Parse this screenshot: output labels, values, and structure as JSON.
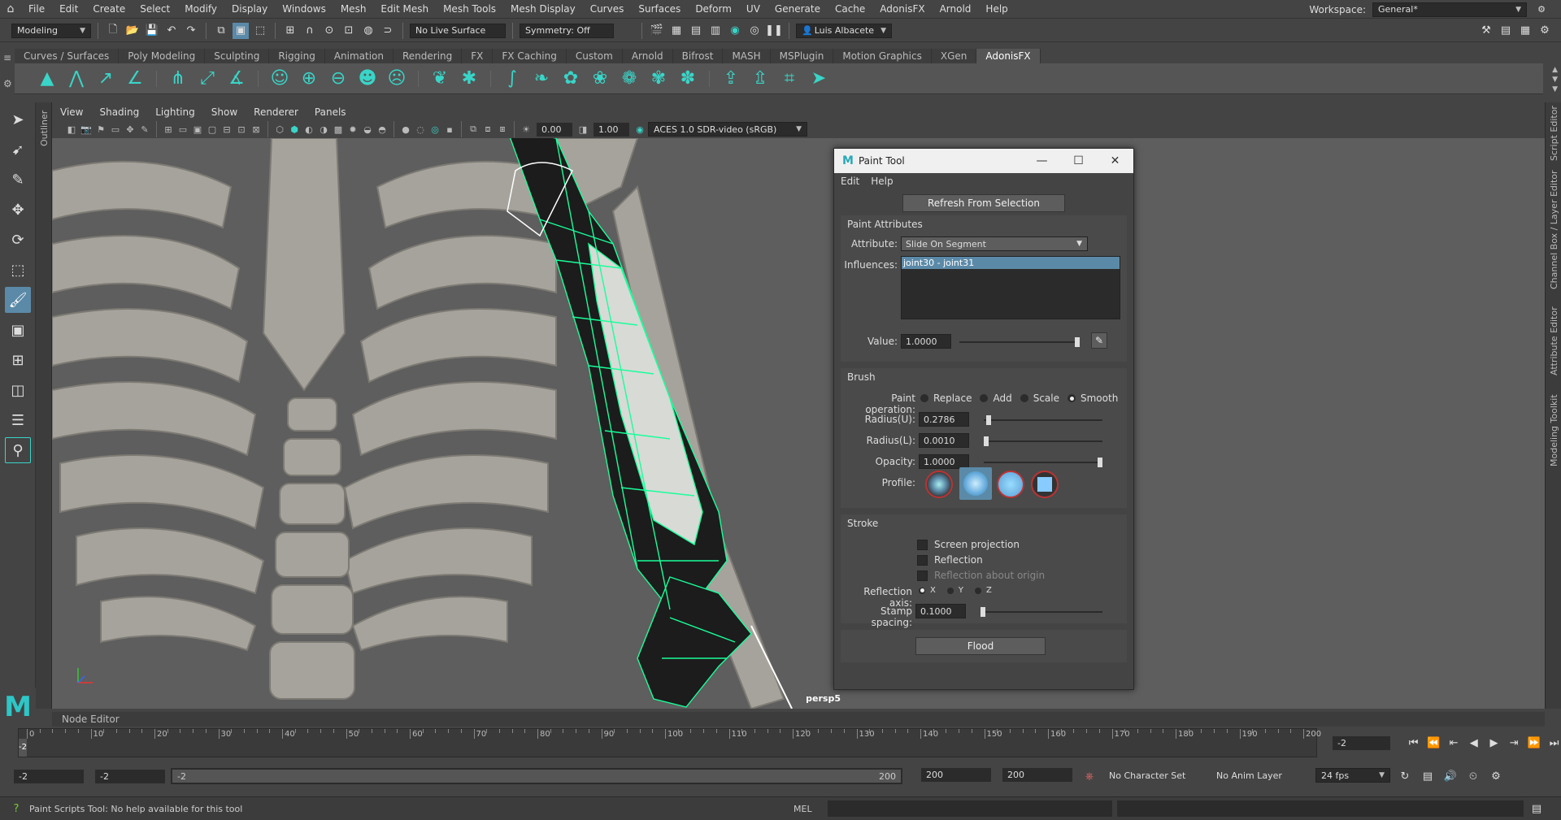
{
  "menubar": {
    "items": [
      "File",
      "Edit",
      "Create",
      "Select",
      "Modify",
      "Display",
      "Windows",
      "Mesh",
      "Edit Mesh",
      "Mesh Tools",
      "Mesh Display",
      "Curves",
      "Surfaces",
      "Deform",
      "UV",
      "Generate",
      "Cache",
      "AdonisFX",
      "Arnold",
      "Help"
    ],
    "workspace_label": "Workspace:",
    "workspace_value": "General*"
  },
  "statusline": {
    "mode": "Modeling",
    "live_surface": "No Live Surface",
    "symmetry": "Symmetry: Off",
    "user": "Luis Albacete"
  },
  "shelf": {
    "tabs": [
      "Curves / Surfaces",
      "Poly Modeling",
      "Sculpting",
      "Rigging",
      "Animation",
      "Rendering",
      "FX",
      "FX Caching",
      "Custom",
      "Arnold",
      "Bifrost",
      "MASH",
      "MSPlugin",
      "Motion Graphics",
      "XGen",
      "AdonisFX"
    ],
    "active_tab": "AdonisFX"
  },
  "outliner_label": "Outliner",
  "panel": {
    "menus": [
      "View",
      "Shading",
      "Lighting",
      "Show",
      "Renderer",
      "Panels"
    ],
    "exposure": "0.00",
    "gamma": "1.00",
    "color_space": "ACES 1.0 SDR-video (sRGB)",
    "camera": "persp5"
  },
  "right_strip": [
    "Script Editor",
    "Channel Box / Layer Editor",
    "Attribute Editor",
    "Modeling Toolkit"
  ],
  "paint_tool": {
    "title": "Paint Tool",
    "menus": [
      "Edit",
      "Help"
    ],
    "refresh_button": "Refresh From Selection",
    "paint_attributes": {
      "header": "Paint Attributes",
      "attribute_label": "Attribute:",
      "attribute_value": "Slide On Segment",
      "influences_label": "Influences:",
      "influences": [
        "joint30 - joint31"
      ],
      "value_label": "Value:",
      "value": "1.0000",
      "value_fraction": 1.0
    },
    "brush": {
      "header": "Brush",
      "operation_label": "Paint operation:",
      "operations": [
        "Replace",
        "Add",
        "Scale",
        "Smooth"
      ],
      "selected_operation": "Smooth",
      "radius_u_label": "Radius(U):",
      "radius_u": "0.2786",
      "radius_u_fraction": 0.02,
      "radius_l_label": "Radius(L):",
      "radius_l": "0.0010",
      "radius_l_fraction": 0.0,
      "opacity_label": "Opacity:",
      "opacity": "1.0000",
      "opacity_fraction": 1.0,
      "profile_label": "Profile:"
    },
    "stroke": {
      "header": "Stroke",
      "screen_projection": "Screen projection",
      "reflection": "Reflection",
      "reflection_origin": "Reflection about origin",
      "reflection_axis_label": "Reflection axis:",
      "axes": [
        "X",
        "Y",
        "Z"
      ],
      "stamp_spacing_label": "Stamp spacing:",
      "stamp_spacing": "0.1000",
      "stamp_spacing_fraction": 0.0
    },
    "flood_button": "Flood"
  },
  "node_editor": "Node Editor",
  "timeline": {
    "ticks": [
      "0",
      "10",
      "20",
      "30",
      "40",
      "50",
      "60",
      "70",
      "80",
      "90",
      "100",
      "110",
      "120",
      "130",
      "140",
      "150",
      "160",
      "170",
      "180",
      "190",
      "200"
    ],
    "current_frame_marker": "-2",
    "current_frame_field": "-2"
  },
  "range": {
    "start": "-2",
    "anim_start": "-2",
    "range_start_label": "-2",
    "range_end_label": "200",
    "anim_end": "200",
    "end": "200",
    "character_set": "No Character Set",
    "anim_layer": "No Anim Layer",
    "fps": "24 fps"
  },
  "help_line": {
    "message": "Paint Scripts Tool: No help available for this tool",
    "mel_label": "MEL"
  },
  "colors": {
    "accent": "#39d5c8",
    "selection": "#5b8aa8",
    "mesh_wire": "#19ff9a"
  }
}
